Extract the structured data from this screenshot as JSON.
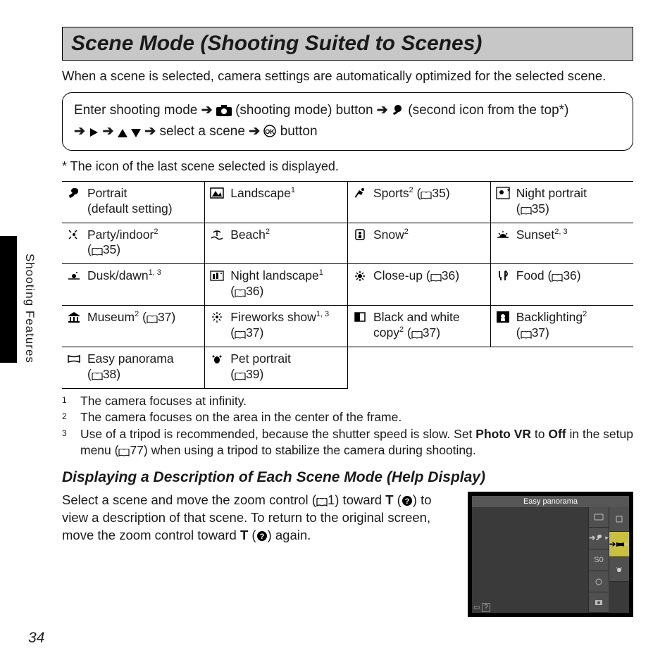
{
  "side_label": "Shooting Features",
  "heading": "Scene Mode (Shooting Suited to Scenes)",
  "intro": "When a scene is selected, camera settings are automatically optimized for the selected scene.",
  "nav": {
    "part1": "Enter shooting mode ",
    "part2": " (shooting mode) button ",
    "part3": " (second icon from the top*)",
    "part4": " select a scene ",
    "part5": " button"
  },
  "star_note": "*   The icon of the last scene selected is displayed.",
  "table": [
    [
      {
        "icon": "portrait-icon",
        "label": "Portrait",
        "sub": "(default setting)"
      },
      {
        "icon": "landscape-icon",
        "label": "Landscape",
        "sup": "1"
      },
      {
        "icon": "sports-icon",
        "label": "Sports",
        "sup": "2",
        "ref": "35"
      },
      {
        "icon": "night-portrait-icon",
        "label": "Night portrait",
        "ref": "35"
      }
    ],
    [
      {
        "icon": "party-icon",
        "label": "Party/indoor",
        "sup": "2",
        "ref": "35"
      },
      {
        "icon": "beach-icon",
        "label": "Beach",
        "sup": "2"
      },
      {
        "icon": "snow-icon",
        "label": "Snow",
        "sup": "2"
      },
      {
        "icon": "sunset-icon",
        "label": "Sunset",
        "sup": "2, 3"
      }
    ],
    [
      {
        "icon": "dusk-icon",
        "label": "Dusk/dawn",
        "sup": "1, 3"
      },
      {
        "icon": "night-landscape-icon",
        "label": "Night landscape",
        "sup": "1",
        "ref": "36"
      },
      {
        "icon": "closeup-icon",
        "label": "Close-up",
        "ref": "36"
      },
      {
        "icon": "food-icon",
        "label": "Food",
        "ref": "36"
      }
    ],
    [
      {
        "icon": "museum-icon",
        "label": "Museum",
        "sup": "2",
        "ref": "37"
      },
      {
        "icon": "fireworks-icon",
        "label": "Fireworks show",
        "sup": "1, 3",
        "ref": "37"
      },
      {
        "icon": "bw-copy-icon",
        "label": "Black and white copy",
        "sup": "2",
        "ref": "37"
      },
      {
        "icon": "backlight-icon",
        "label": "Backlighting",
        "sup": "2",
        "ref": "37"
      }
    ],
    [
      {
        "icon": "panorama-icon",
        "label": "Easy panorama",
        "ref": "38"
      },
      {
        "icon": "pet-icon",
        "label": "Pet portrait",
        "ref": "39"
      },
      null,
      null
    ]
  ],
  "footnotes": [
    {
      "n": "1",
      "text": "The camera focuses at infinity."
    },
    {
      "n": "2",
      "text": "The camera focuses on the area in the center of the frame."
    },
    {
      "n": "3",
      "text_a": "Use of a tripod is recommended, because the shutter speed is slow. Set ",
      "bold": "Photo VR",
      "text_b": " to ",
      "bold2": "Off",
      "text_c": " in the setup menu (",
      "ref": "77",
      "text_d": ") when using a tripod to stabilize the camera during shooting."
    }
  ],
  "subhead": "Displaying a Description of Each Scene Mode (Help Display)",
  "help": {
    "part1": "Select a scene and move the zoom control (",
    "ref1": "1",
    "part2": ") toward ",
    "tglyph": "T",
    "part3": " (",
    "part4": ") to view a description of that scene. To return to the original screen, move the zoom control toward ",
    "part5": " (",
    "part6": ") again."
  },
  "lcd": {
    "title": "Easy panorama",
    "so": "S0"
  },
  "page_number": "34"
}
